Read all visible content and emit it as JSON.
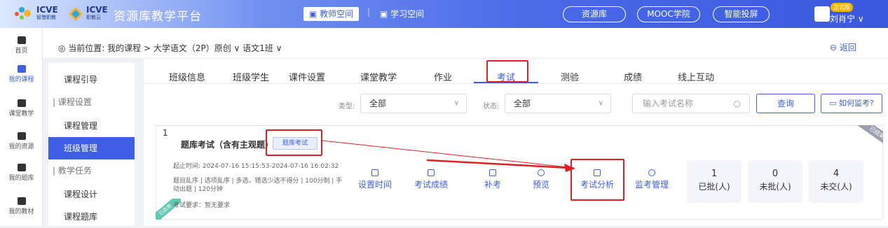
{
  "header": {
    "logo1_text": "ICVE",
    "logo1_sub": "智慧职教",
    "logo2_text": "ICVE",
    "logo2_sub": "职教云",
    "platform_title": "资源库教学平台",
    "teacher_space": "教师空间",
    "separator": "|",
    "learning_space": "学习空间",
    "nav_buttons": [
      "资源库",
      "MOOC学院",
      "智能投屏"
    ],
    "vip_badge": "正式版",
    "username": "刘肖宁 ∨"
  },
  "rail": [
    {
      "label": "首页",
      "icon": "home-icon"
    },
    {
      "label": "我的课程",
      "icon": "book-icon"
    },
    {
      "label": "课堂教学",
      "icon": "play-icon"
    },
    {
      "label": "我的资源",
      "icon": "folder-icon"
    },
    {
      "label": "我的题库",
      "icon": "question-bank-icon"
    },
    {
      "label": "我的教材",
      "icon": "textbook-icon"
    }
  ],
  "breadcrumb": {
    "text": "当前位置: 我的课程 > 大学语文（2P）原创 ∨  语文1班 ∨",
    "back": "返回"
  },
  "subnav": [
    {
      "label": "课程引导",
      "type": "item"
    },
    {
      "label": "| 课程设置",
      "type": "group"
    },
    {
      "label": "课程管理",
      "type": "item"
    },
    {
      "label": "班级管理",
      "type": "active"
    },
    {
      "label": "| 教学任务",
      "type": "group"
    },
    {
      "label": "课程设计",
      "type": "item"
    },
    {
      "label": "课程题库",
      "type": "item"
    }
  ],
  "tabs": [
    "班级信息",
    "班级学生",
    "课件设置",
    "课堂教学",
    "作业",
    "考试",
    "测验",
    "成绩",
    "线上互动"
  ],
  "filters": {
    "type_label": "类型:",
    "type_value": "全部",
    "status_label": "状态:",
    "status_value": "全部",
    "search_placeholder": "输入考试名称",
    "query_button": "查询",
    "monitor_help": "如何监考?"
  },
  "exam": {
    "index": "1",
    "title": "题库考试（含有主观题）",
    "tag": "题库考试",
    "deadline": "起止时间: 2024-07-16 15:15:53-2024-07-16 16:02:32",
    "rules": "题目乱序 | 选项乱序 | 多选、错选少选不得分 | 100分制 | 手动出题 | 120分钟",
    "requirement": "考试要求：暂无要求",
    "ended_ribbon": "已结束",
    "published_ribbon": "已启用",
    "actions": [
      {
        "label": "设置时间",
        "icon": "clock-icon"
      },
      {
        "label": "考试成绩",
        "icon": "score-icon"
      },
      {
        "label": "补考",
        "icon": "retake-icon"
      },
      {
        "label": "预览",
        "icon": "eye-icon"
      },
      {
        "label": "考试分析",
        "icon": "chart-icon"
      },
      {
        "label": "监考管理",
        "icon": "monitor-icon"
      }
    ],
    "stats": [
      {
        "value": "1",
        "label": "已批(人)"
      },
      {
        "value": "0",
        "label": "未批(人)"
      },
      {
        "value": "4",
        "label": "未交(人)"
      }
    ]
  },
  "colors": {
    "accent": "#3d5ee5",
    "highlight": "#e02020"
  }
}
